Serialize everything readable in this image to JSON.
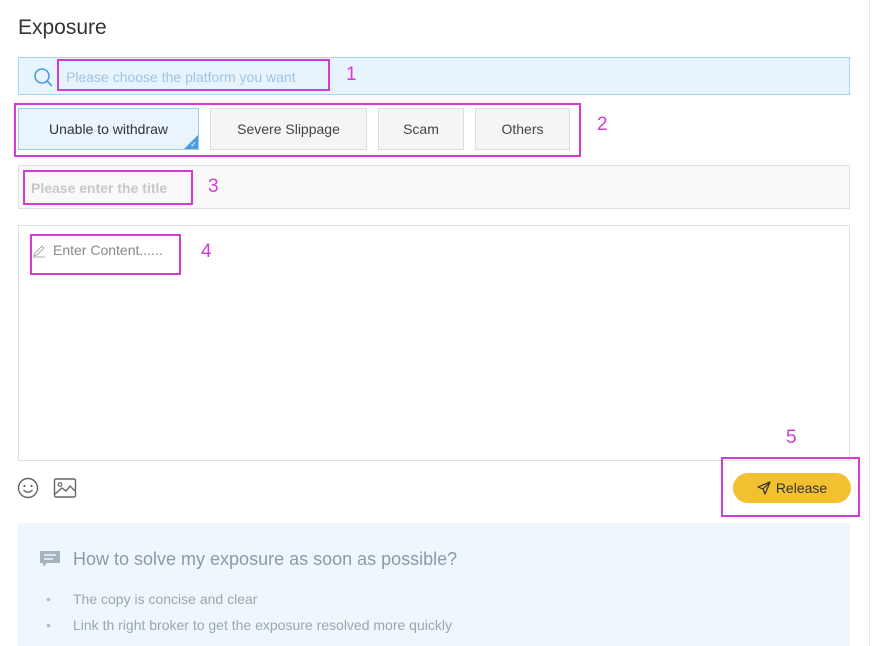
{
  "page": {
    "title": "Exposure"
  },
  "search": {
    "placeholder": "Please choose the platform you want"
  },
  "tags": [
    {
      "label": "Unable to withdraw",
      "selected": true
    },
    {
      "label": "Severe Slippage",
      "selected": false
    },
    {
      "label": "Scam",
      "selected": false
    },
    {
      "label": "Others",
      "selected": false
    }
  ],
  "title_field": {
    "placeholder": "Please enter the title"
  },
  "content_field": {
    "placeholder": "Enter Content......"
  },
  "toolbar": {
    "emoji_icon": "smile-icon",
    "image_icon": "image-icon"
  },
  "release_button": {
    "label": "Release",
    "icon": "send-icon",
    "color": "#f3c12f"
  },
  "tips": {
    "heading": "How to solve my exposure as soon as possible?",
    "items": [
      "The copy is concise and clear",
      "Link th right broker to get the exposure resolved more quickly"
    ],
    "dot": "•"
  },
  "annotations": [
    "1",
    "2",
    "3",
    "4",
    "5"
  ],
  "colors": {
    "accent": "#4a9ee0",
    "annotation": "#d43ad8",
    "tips_bg": "#eef7fd"
  }
}
